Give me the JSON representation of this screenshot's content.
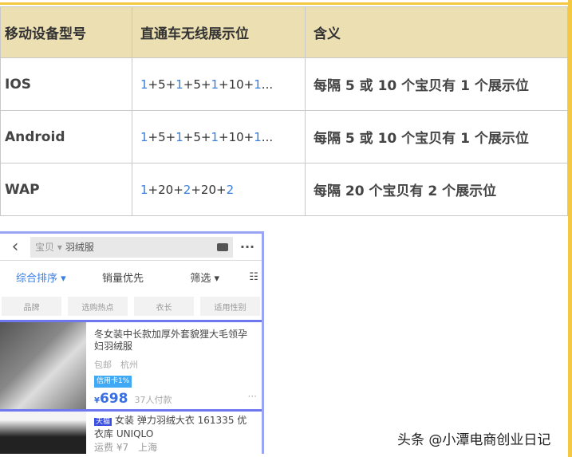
{
  "table": {
    "headers": [
      "移动设备型号",
      "直通车无线展示位",
      "含义"
    ],
    "rows": [
      {
        "device": "IOS",
        "sequence": [
          {
            "t": "1",
            "hl": true
          },
          {
            "t": "+5+",
            "hl": false
          },
          {
            "t": "1",
            "hl": true
          },
          {
            "t": "+5+",
            "hl": false
          },
          {
            "t": "1",
            "hl": true
          },
          {
            "t": "+10+",
            "hl": false
          },
          {
            "t": "1",
            "hl": true
          },
          {
            "t": "...",
            "hl": false
          }
        ],
        "meaning": "每隔 5 或 10 个宝贝有 1 个展示位"
      },
      {
        "device": "Android",
        "sequence": [
          {
            "t": "1",
            "hl": true
          },
          {
            "t": "+5+",
            "hl": false
          },
          {
            "t": "1",
            "hl": true
          },
          {
            "t": "+5+",
            "hl": false
          },
          {
            "t": "1",
            "hl": true
          },
          {
            "t": "+10+",
            "hl": false
          },
          {
            "t": "1",
            "hl": true
          },
          {
            "t": "...",
            "hl": false
          }
        ],
        "meaning": "每隔 5 或 10 个宝贝有 1 个展示位"
      },
      {
        "device": "WAP",
        "sequence": [
          {
            "t": "1",
            "hl": true
          },
          {
            "t": "+20+",
            "hl": false
          },
          {
            "t": "2",
            "hl": true
          },
          {
            "t": "+20+",
            "hl": false
          },
          {
            "t": "2",
            "hl": true
          }
        ],
        "meaning": "每隔 20 个宝贝有 2 个展示位"
      }
    ]
  },
  "phone": {
    "search_scope": "宝贝 ▾",
    "search_query": "羽绒服",
    "sort": [
      "综合排序 ▾",
      "销量优先",
      "筛选 ▾"
    ],
    "chips": [
      "品牌",
      "选购热点",
      "衣长",
      "适用性别"
    ],
    "items": [
      {
        "title": "冬女装中长款加厚外套貌狸大毛领孕妇羽绒服",
        "meta": "包邮　杭州",
        "tag": "信用卡1%",
        "price": "698",
        "currency": "¥",
        "sold": "37人付款"
      },
      {
        "badge": "天猫",
        "title": "女装 弹力羽绒大衣 161335 优衣库 UNIQLO",
        "meta": "运费 ¥7　上海"
      }
    ]
  },
  "watermark": "头条 @小潭电商创业日记"
}
